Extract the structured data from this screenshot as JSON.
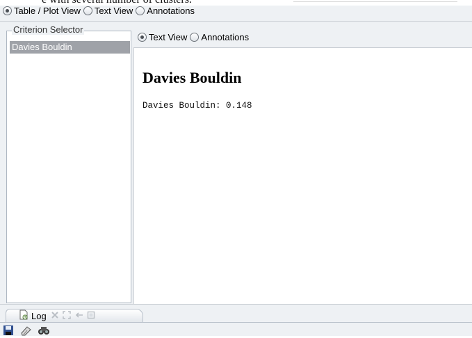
{
  "document_fragment": {
    "cut_text": "e with several number of clusters."
  },
  "view_mode": {
    "options": [
      "Table / Plot View",
      "Text View",
      "Annotations"
    ],
    "selected": "Table / Plot View"
  },
  "criterion_selector": {
    "title": "Criterion Selector",
    "items": [
      "Davies Bouldin"
    ],
    "selected": "Davies Bouldin"
  },
  "inner_view_mode": {
    "options": [
      "Text View",
      "Annotations"
    ],
    "selected": "Text View"
  },
  "result": {
    "heading": "Davies Bouldin",
    "line": "Davies Bouldin: 0.148"
  },
  "log_panel": {
    "tab_label": "Log",
    "icons": [
      "log-icon",
      "close-icon",
      "maximize-icon",
      "dock-icon",
      "restore-icon"
    ]
  },
  "toolbar": {
    "icons": [
      "save-icon",
      "clear-icon",
      "search-icon"
    ]
  }
}
